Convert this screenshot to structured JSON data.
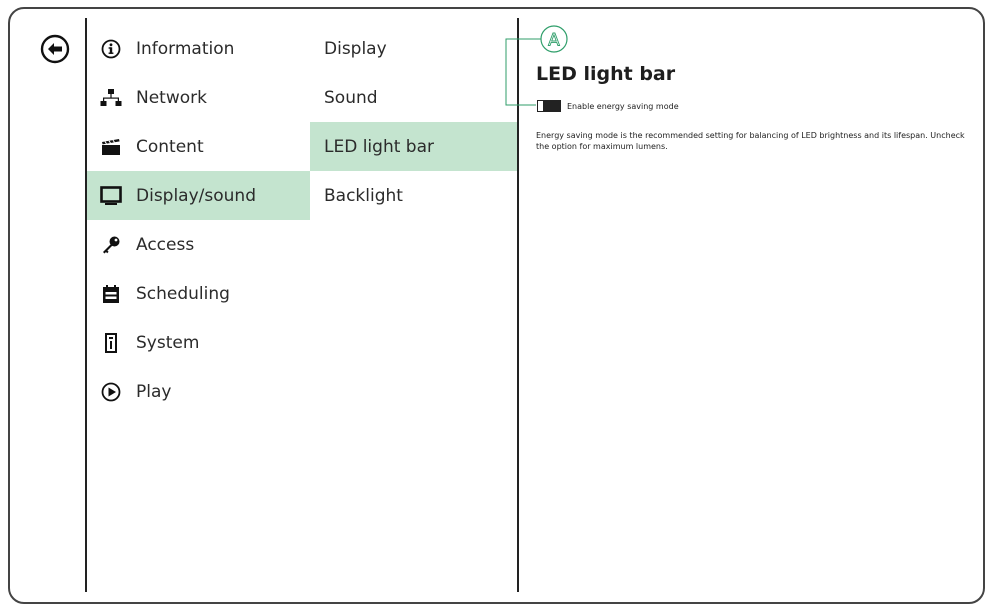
{
  "navigation": {
    "back_icon": "back-arrow-icon",
    "items": [
      {
        "label": "Information",
        "icon": "info-icon",
        "selected": false
      },
      {
        "label": "Network",
        "icon": "network-icon",
        "selected": false
      },
      {
        "label": "Content",
        "icon": "clapperboard-icon",
        "selected": false
      },
      {
        "label": "Display/sound",
        "icon": "monitor-icon",
        "selected": true
      },
      {
        "label": "Access",
        "icon": "key-icon",
        "selected": false
      },
      {
        "label": "Scheduling",
        "icon": "calendar-icon",
        "selected": false
      },
      {
        "label": "System",
        "icon": "system-icon",
        "selected": false
      },
      {
        "label": "Play",
        "icon": "play-icon",
        "selected": false
      }
    ]
  },
  "subnav": {
    "items": [
      {
        "label": "Display",
        "selected": false
      },
      {
        "label": "Sound",
        "selected": false
      },
      {
        "label": "LED light bar",
        "selected": true
      },
      {
        "label": "Backlight",
        "selected": false
      }
    ]
  },
  "main": {
    "callout_letter": "A",
    "title": "LED light bar",
    "toggle": {
      "label": "Enable energy saving mode",
      "state": "on"
    },
    "description": "Energy saving mode is the recommended setting for balancing of LED brightness and its lifespan. Uncheck the option for maximum lumens."
  },
  "colors": {
    "selected_bg": "#c4e4cf",
    "border": "#444444",
    "callout": "#2f9e6a"
  }
}
